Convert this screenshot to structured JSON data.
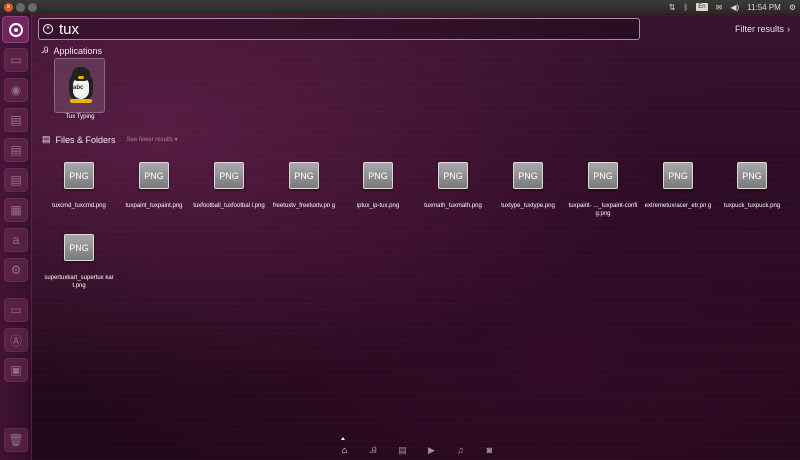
{
  "top_panel": {
    "clock": "11:54 PM",
    "keyboard_layout": "En"
  },
  "search": {
    "query": "tux",
    "filter_label": "Filter results"
  },
  "applications": {
    "header": "Applications",
    "items": [
      {
        "label": "Tux Typing",
        "badge": "abc"
      }
    ]
  },
  "files": {
    "header": "Files & Folders",
    "see_fewer": "See fewer results",
    "icon_text": "PNG",
    "items": [
      {
        "label": "tuxcmd_tuxcmd.png"
      },
      {
        "label": "tuxpaint_tuxpaint.png"
      },
      {
        "label": "tuxfootball_tuxfootbal l.png"
      },
      {
        "label": "freetuxtv_freetuxtv.pn g"
      },
      {
        "label": "iptux_ip-tux.png"
      },
      {
        "label": "tuxmath_tuxmath.png"
      },
      {
        "label": "tuxtype_tuxtype.png"
      },
      {
        "label": "tuxpaint- ..._tuxpaint-config.png"
      },
      {
        "label": "extremetuxracer_etr.pn g"
      },
      {
        "label": "tuxpuck_tuxpuck.png"
      },
      {
        "label": "supertuxkart_supertux kart.png"
      }
    ]
  },
  "colors": {
    "dash_tint": "#2a0d22",
    "accent": "#a03c78",
    "close_button": "#e0562c"
  },
  "lenses": [
    "home-icon",
    "applications-icon",
    "files-icon",
    "video-icon",
    "music-icon",
    "photos-icon"
  ]
}
